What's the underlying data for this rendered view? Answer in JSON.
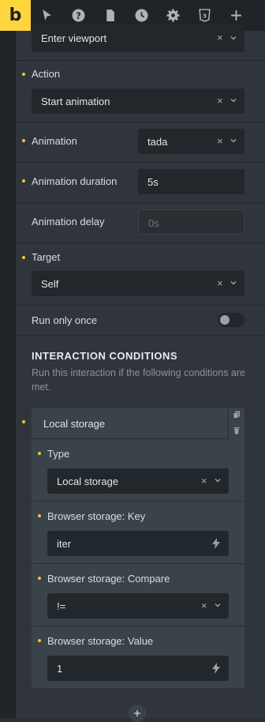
{
  "toolbar": {
    "logo": "b",
    "icons": [
      "pointer-icon",
      "help-icon",
      "page-icon",
      "history-icon",
      "settings-icon",
      "css3-icon",
      "add-icon"
    ]
  },
  "interaction": {
    "trigger_value": "Enter viewport",
    "action_label": "Action",
    "action_value": "Start animation",
    "animation_label": "Animation",
    "animation_value": "tada",
    "duration_label": "Animation duration",
    "duration_value": "5s",
    "delay_label": "Animation delay",
    "delay_placeholder": "0s",
    "target_label": "Target",
    "target_value": "Self",
    "run_once_label": "Run only once",
    "run_once_enabled": false
  },
  "conditions": {
    "title": "INTERACTION CONDITIONS",
    "description": "Run this interaction if the following conditions are met.",
    "item_title": "Local storage",
    "type_label": "Type",
    "type_value": "Local storage",
    "key_label": "Browser storage: Key",
    "key_value": "iter",
    "compare_label": "Browser storage: Compare",
    "compare_value": "!=",
    "value_label": "Browser storage: Value",
    "value_value": "1"
  },
  "clear_symbol": "×",
  "colors": {
    "accent": "#ffd53d",
    "dot": "#f0c53a",
    "panel": "#2f353b",
    "input": "#22272b"
  }
}
